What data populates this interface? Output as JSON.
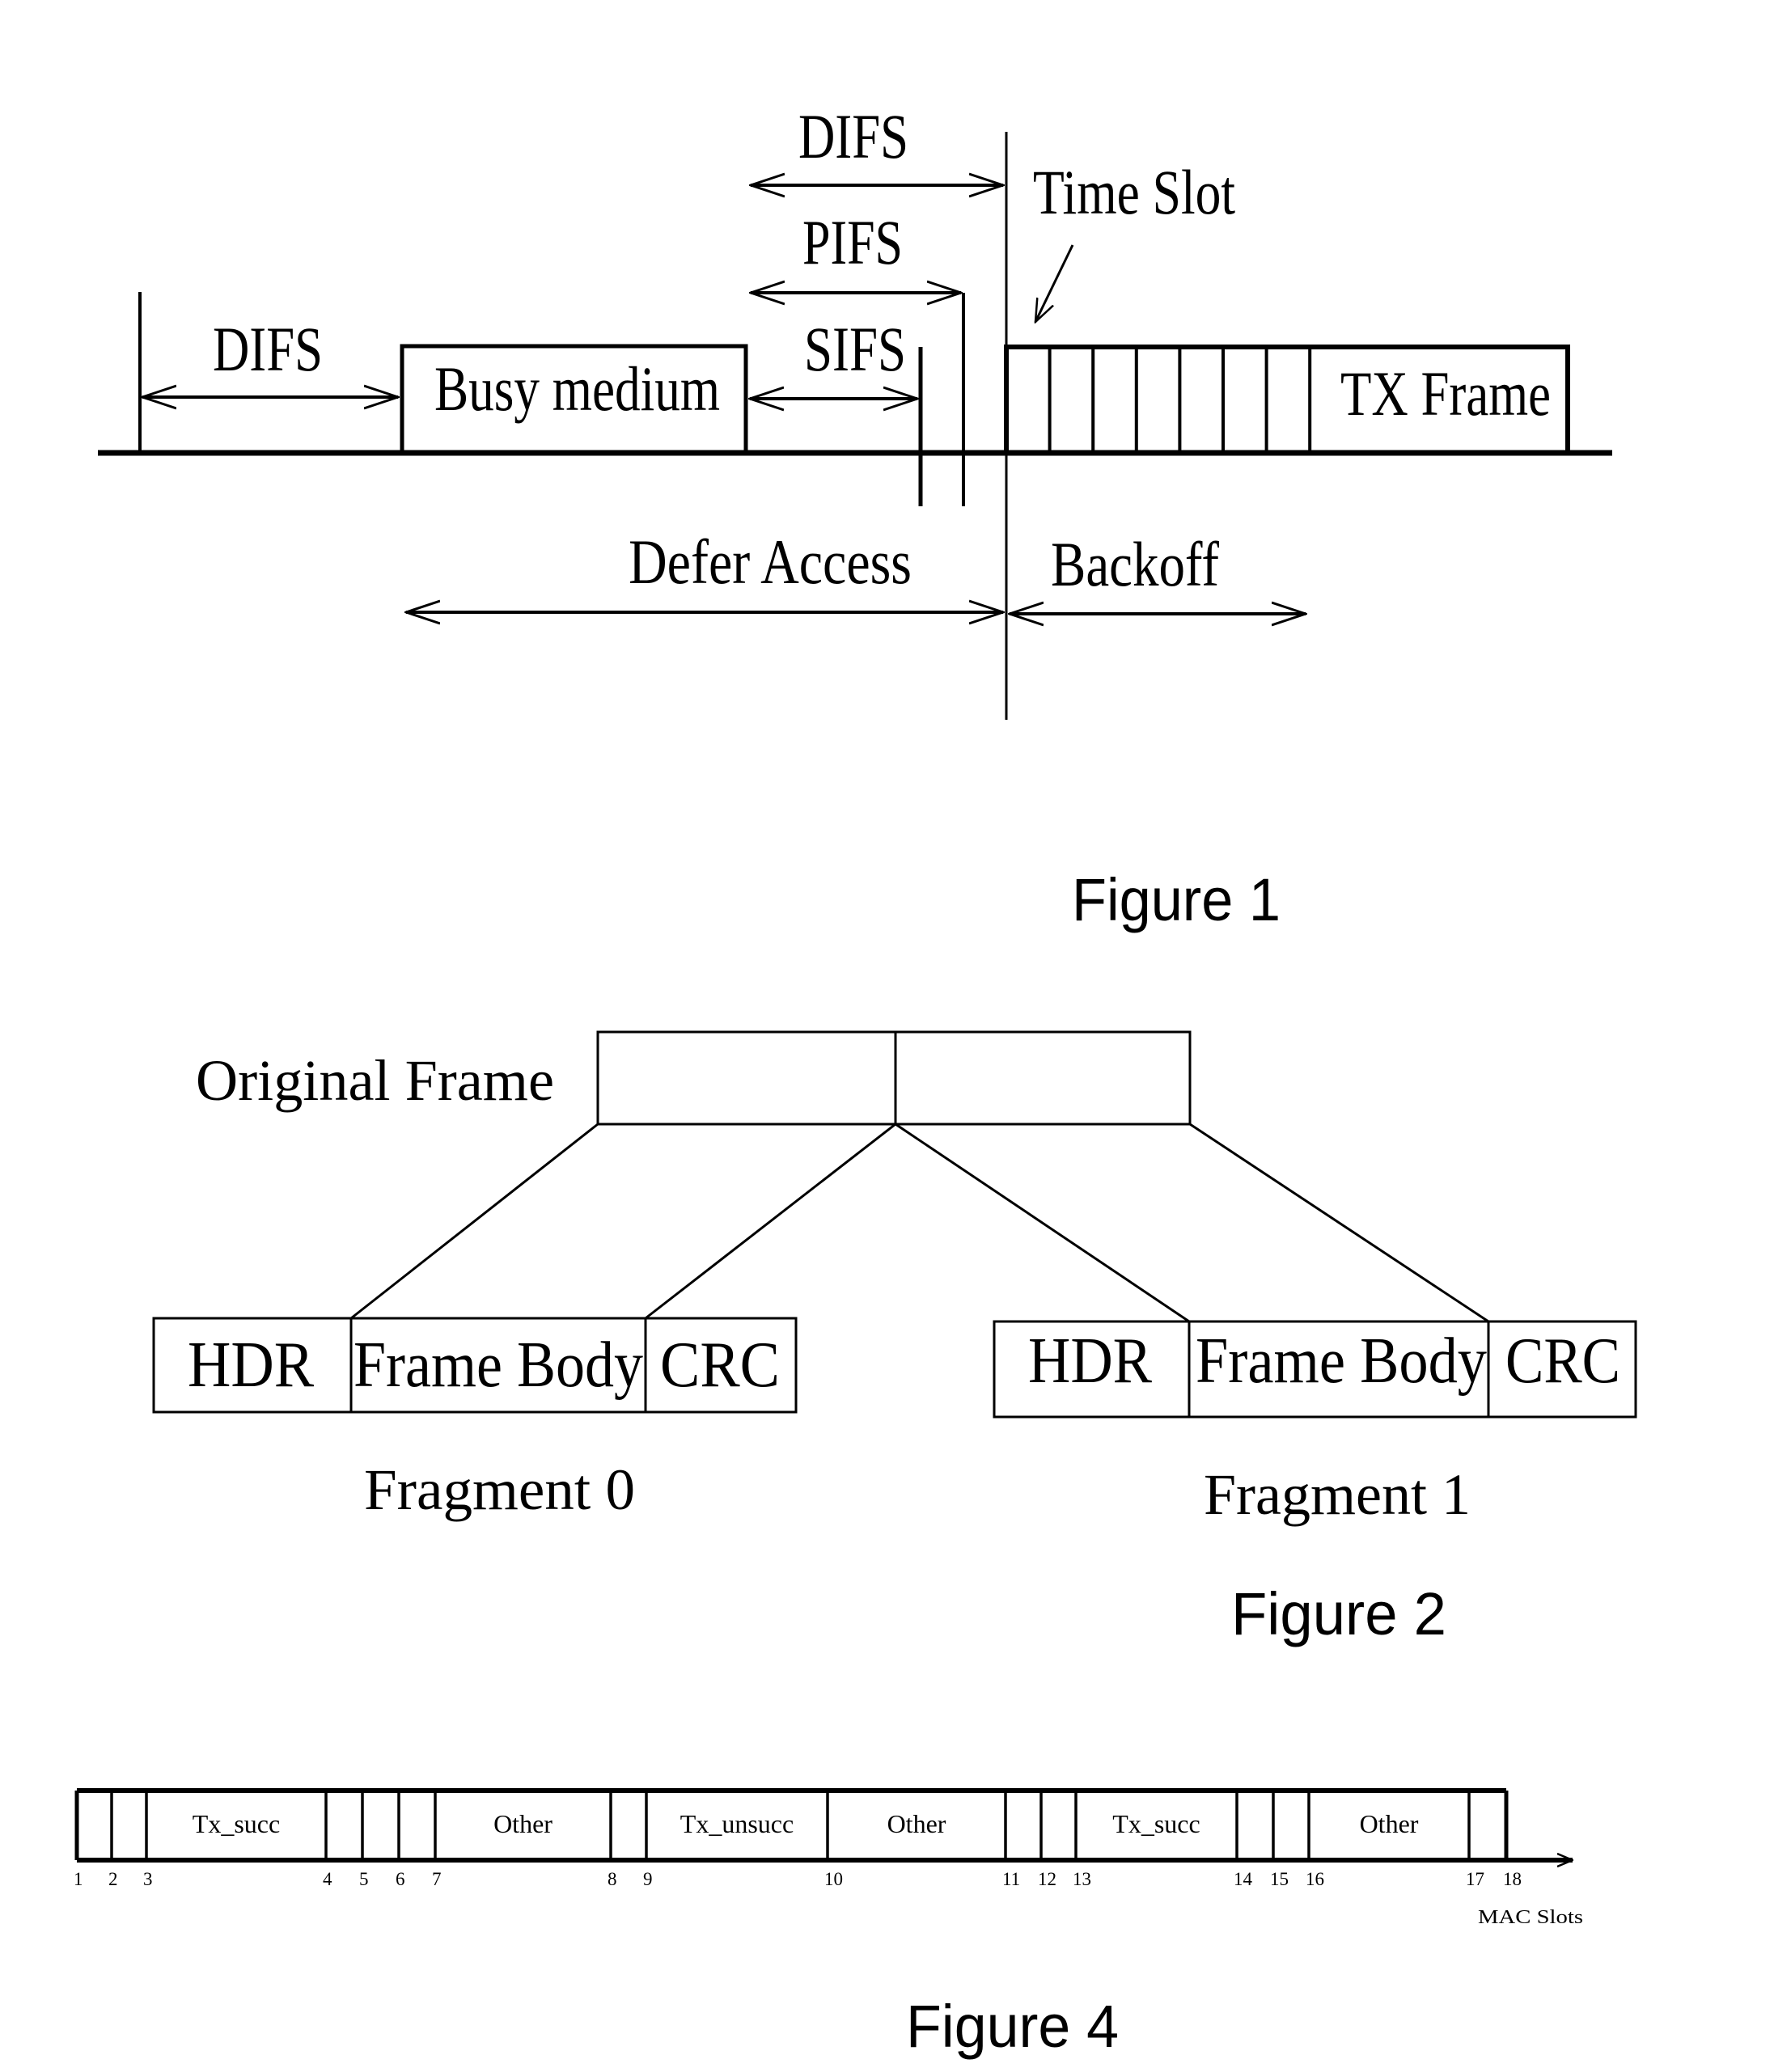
{
  "figure1": {
    "caption": "Figure 1",
    "labels": {
      "difs_top": "DIFS",
      "pifs": "PIFS",
      "sifs": "SIFS",
      "difs_left": "DIFS",
      "time_slot": "Time Slot",
      "busy_medium": "Busy medium",
      "tx_frame": "TX Frame",
      "defer_access": "Defer Access",
      "backoff": "Backoff"
    },
    "backoff_slot_count": 7
  },
  "figure2": {
    "caption": "Figure 2",
    "original_frame_label": "Original Frame",
    "fragments": [
      {
        "label": "Fragment 0",
        "fields": [
          "HDR",
          "Frame Body",
          "CRC"
        ]
      },
      {
        "label": "Fragment 1",
        "fields": [
          "HDR",
          "Frame Body",
          "CRC"
        ]
      }
    ]
  },
  "figure4": {
    "caption": "Figure 4",
    "axis_label": "MAC Slots",
    "slot_numbers": [
      "1",
      "2",
      "3",
      "4",
      "5",
      "6",
      "7",
      "8",
      "9",
      "10",
      "11",
      "12",
      "13",
      "14",
      "15",
      "16",
      "17",
      "18"
    ],
    "segments": [
      {
        "from": 1,
        "to": 2,
        "label": ""
      },
      {
        "from": 2,
        "to": 3,
        "label": ""
      },
      {
        "from": 3,
        "to": 4,
        "label": "Tx_succ"
      },
      {
        "from": 4,
        "to": 5,
        "label": ""
      },
      {
        "from": 5,
        "to": 6,
        "label": ""
      },
      {
        "from": 6,
        "to": 7,
        "label": ""
      },
      {
        "from": 7,
        "to": 8,
        "label": "Other"
      },
      {
        "from": 8,
        "to": 9,
        "label": ""
      },
      {
        "from": 9,
        "to": 10,
        "label": "Tx_unsucc"
      },
      {
        "from": 10,
        "to": 11,
        "label": "Other"
      },
      {
        "from": 11,
        "to": 12,
        "label": ""
      },
      {
        "from": 12,
        "to": 13,
        "label": ""
      },
      {
        "from": 13,
        "to": 14,
        "label": "Tx_succ"
      },
      {
        "from": 14,
        "to": 15,
        "label": ""
      },
      {
        "from": 15,
        "to": 16,
        "label": ""
      },
      {
        "from": 16,
        "to": 17,
        "label": "Other"
      },
      {
        "from": 17,
        "to": 18,
        "label": ""
      }
    ]
  }
}
